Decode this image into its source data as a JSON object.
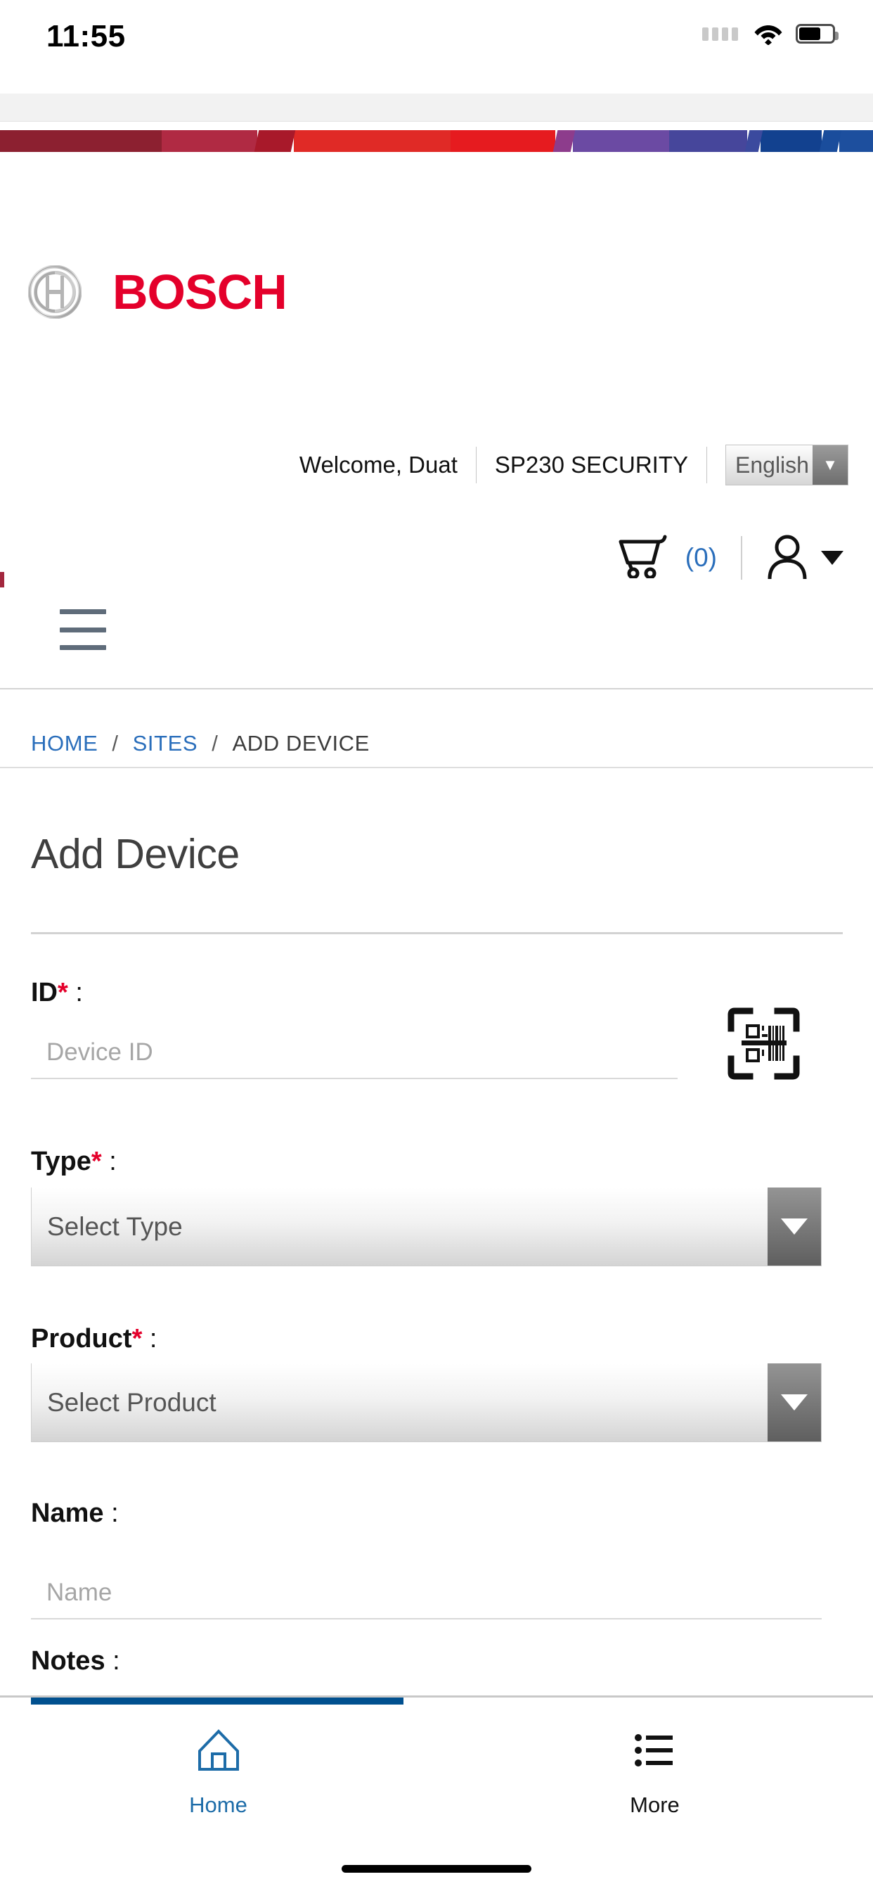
{
  "status_bar": {
    "time": "11:55",
    "signal_icon": "signal-dots-icon",
    "wifi_icon": "wifi-icon",
    "battery_icon": "battery-icon"
  },
  "brand": {
    "logo_mark_icon": "bosch-anchor-icon",
    "wordmark": "BOSCH",
    "wordmark_color": "#e4002b",
    "supergraphic_colors": [
      "#8c2030",
      "#b02a43",
      "#a8192a",
      "#e02a26",
      "#e61b1f",
      "#6b4aa3",
      "#5a4ba5",
      "#46469b",
      "#17459b",
      "#1b4fa0",
      "#1d4f9e"
    ]
  },
  "header": {
    "welcome": "Welcome, Duat",
    "account_name": "SP230 SECURITY",
    "language": {
      "value": "English",
      "arrow_icon": "chevron-down-icon"
    },
    "cart": {
      "icon": "shopping-cart-icon",
      "count_label": "(0)",
      "count_color": "#2a6ebb"
    },
    "user": {
      "icon": "person-icon",
      "arrow_icon": "caret-down-icon"
    },
    "menu_icon": "hamburger-menu-icon"
  },
  "breadcrumb": {
    "items": [
      {
        "label": "HOME",
        "current": false
      },
      {
        "label": "SITES",
        "current": false
      },
      {
        "label": "ADD DEVICE",
        "current": true
      }
    ],
    "separator": "/"
  },
  "page": {
    "title": "Add Device"
  },
  "form": {
    "id": {
      "label": "ID",
      "required_mark": "*",
      "colon": ":",
      "placeholder": "Device ID",
      "value": "",
      "scan_icon": "barcode-scanner-icon"
    },
    "type": {
      "label": "Type",
      "required_mark": "*",
      "colon": ":",
      "selected": "Select Type",
      "arrow_icon": "chevron-down-icon"
    },
    "product": {
      "label": "Product",
      "required_mark": "*",
      "colon": ":",
      "selected": "Select Product",
      "arrow_icon": "chevron-down-icon"
    },
    "name": {
      "label": "Name",
      "colon": ":",
      "placeholder": "Name",
      "value": ""
    },
    "notes": {
      "label": "Notes",
      "colon": ":"
    }
  },
  "tabbar": {
    "accent_color": "#00508f",
    "tabs": [
      {
        "label": "Home",
        "icon": "home-icon",
        "active": true
      },
      {
        "label": "More",
        "icon": "list-icon",
        "active": false
      }
    ]
  }
}
